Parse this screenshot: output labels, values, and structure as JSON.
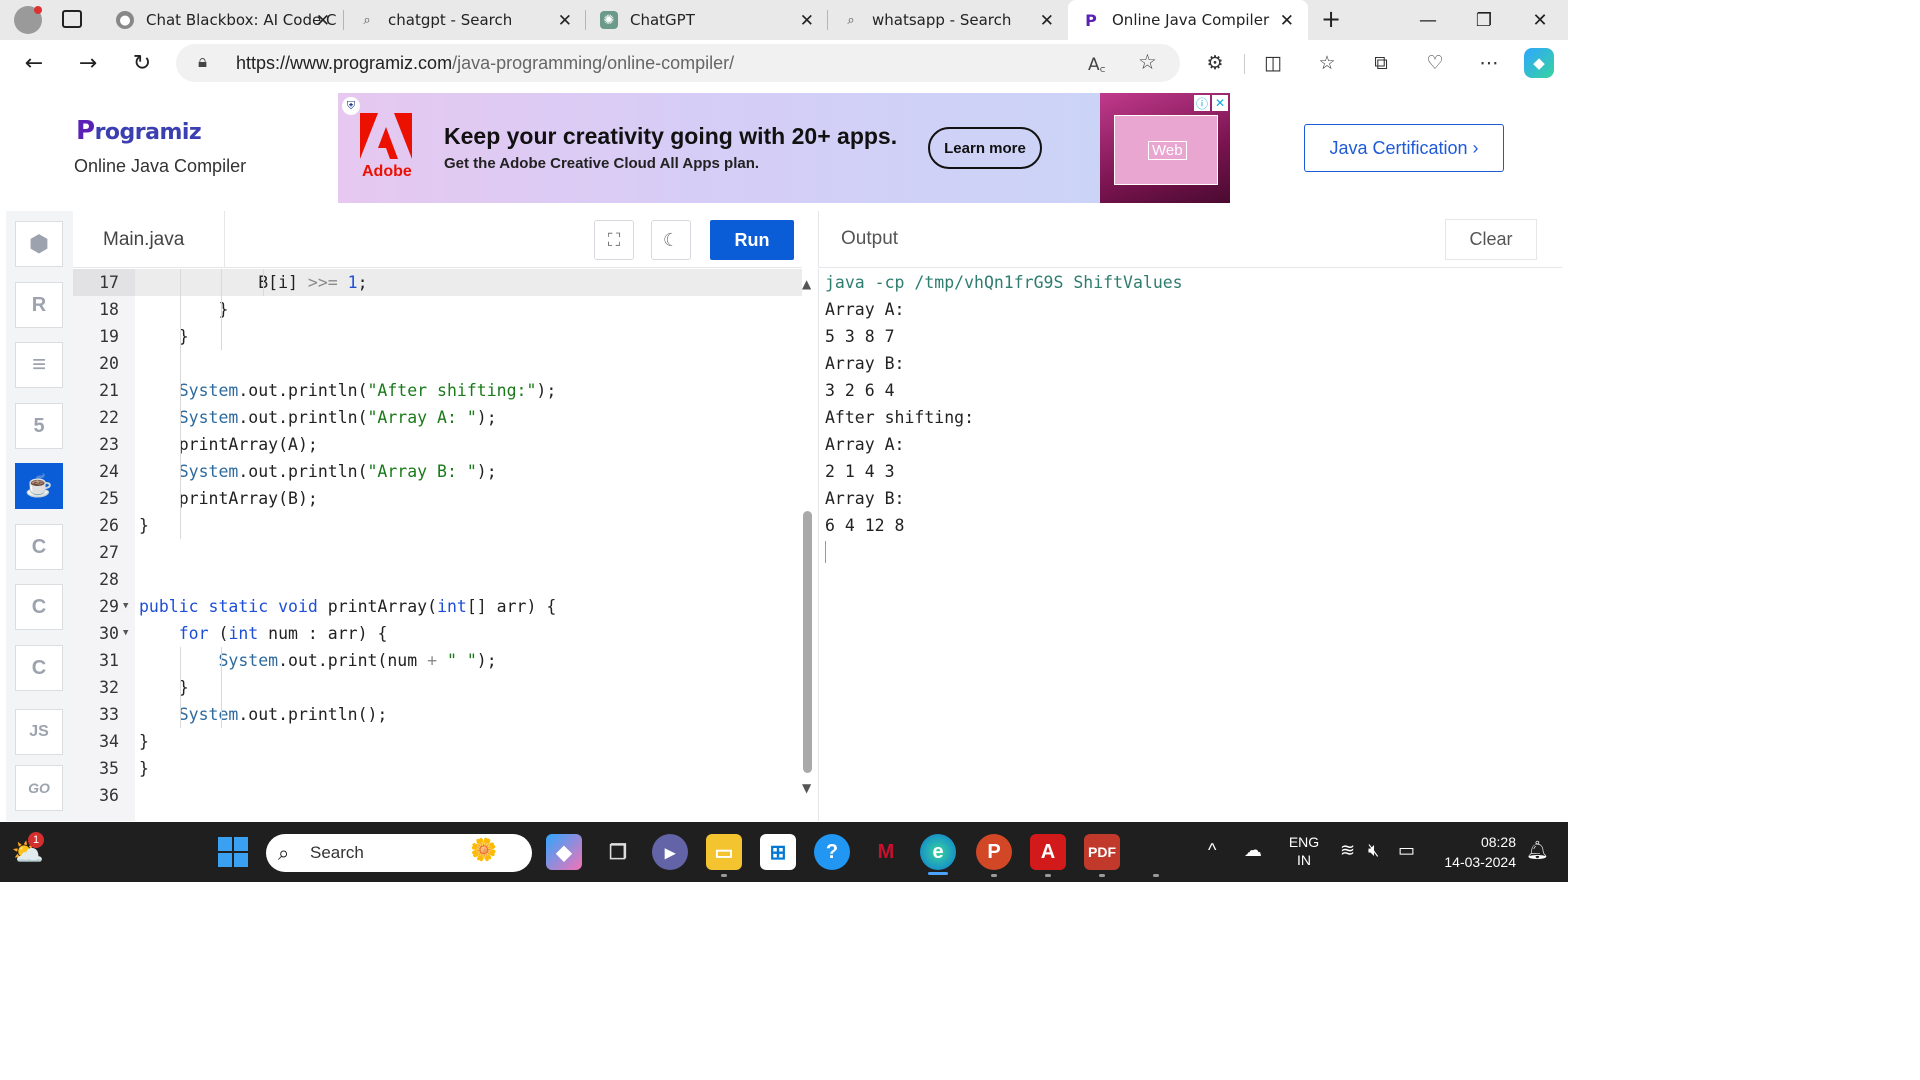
{
  "browser": {
    "tabs": [
      {
        "title": "Chat Blackbox: AI Code C",
        "icon": "blackbox-icon"
      },
      {
        "title": "chatgpt - Search",
        "icon": "search-icon"
      },
      {
        "title": "ChatGPT",
        "icon": "chatgpt-icon"
      },
      {
        "title": "whatsapp - Search",
        "icon": "search-icon"
      },
      {
        "title": "Online Java Compiler",
        "icon": "programiz-icon",
        "active": true
      }
    ],
    "url_host": "https://www.programiz.com",
    "url_path": "/java-programming/online-compiler/"
  },
  "site": {
    "logo_text": "rogramiz",
    "logo_initial": "P",
    "subtitle": "Online Java Compiler",
    "cert_button": "Java Certification ›"
  },
  "ad": {
    "brand": "Adobe",
    "headline": "Keep your creativity going with 20+ apps.",
    "subline": "Get the Adobe Creative Cloud All Apps plan.",
    "cta": "Learn more",
    "image_word": "Web"
  },
  "sidebar": {
    "languages": [
      {
        "name": "python-icon",
        "glyph": "🐍"
      },
      {
        "name": "r-icon",
        "glyph": "R"
      },
      {
        "name": "sql-icon",
        "glyph": "≡"
      },
      {
        "name": "html5-icon",
        "glyph": "5"
      },
      {
        "name": "java-icon",
        "glyph": "☕",
        "active": true
      },
      {
        "name": "c-icon",
        "glyph": "C"
      },
      {
        "name": "cpp-icon",
        "glyph": "C"
      },
      {
        "name": "csharp-icon",
        "glyph": "C"
      },
      {
        "name": "javascript-icon",
        "glyph": "JS"
      },
      {
        "name": "go-icon",
        "glyph": "GO"
      }
    ]
  },
  "editor": {
    "file_name": "Main.java",
    "run_label": "Run",
    "lines": [
      {
        "n": "17",
        "html": "            B[i] <span class=\"op\">>>=</span> <span class=\"num\">1</span>;",
        "hl": true
      },
      {
        "n": "18",
        "html": "        }"
      },
      {
        "n": "19",
        "html": "    }"
      },
      {
        "n": "20",
        "html": ""
      },
      {
        "n": "21",
        "html": "    <span class=\"fn\">System</span>.out.println(<span class=\"str\">\"After shifting:\"</span>);"
      },
      {
        "n": "22",
        "html": "    <span class=\"fn\">System</span>.out.println(<span class=\"str\">\"Array A: \"</span>);"
      },
      {
        "n": "23",
        "html": "    printArray(A);"
      },
      {
        "n": "24",
        "html": "    <span class=\"fn\">System</span>.out.println(<span class=\"str\">\"Array B: \"</span>);"
      },
      {
        "n": "25",
        "html": "    printArray(B);"
      },
      {
        "n": "26",
        "html": "}"
      },
      {
        "n": "27",
        "html": ""
      },
      {
        "n": "28",
        "html": ""
      },
      {
        "n": "29",
        "fold": true,
        "html": "<span class=\"kw\">public</span> <span class=\"kw\">static</span> <span class=\"kw\">void</span> printArray(<span class=\"kw\">int</span>[] arr) {"
      },
      {
        "n": "30",
        "fold": true,
        "html": "    <span class=\"kw\">for</span> (<span class=\"kw\">int</span> num : arr) {"
      },
      {
        "n": "31",
        "html": "        <span class=\"fn\">System</span>.out.print(num <span class=\"op\">+</span> <span class=\"str\">\" \"</span>);"
      },
      {
        "n": "32",
        "html": "    }"
      },
      {
        "n": "33",
        "html": "    <span class=\"fn\">System</span>.out.println();"
      },
      {
        "n": "34",
        "html": "}"
      },
      {
        "n": "35",
        "html": "}"
      },
      {
        "n": "36",
        "html": ""
      }
    ]
  },
  "output": {
    "title": "Output",
    "clear_label": "Clear",
    "lines": [
      {
        "text": "java -cp /tmp/vhQn1frG9S ShiftValues",
        "cmd": true
      },
      {
        "text": "Array A:"
      },
      {
        "text": "5 3 8 7"
      },
      {
        "text": "Array B:"
      },
      {
        "text": "3 2 6 4"
      },
      {
        "text": "After shifting:"
      },
      {
        "text": "Array A:"
      },
      {
        "text": "2 1 4 3"
      },
      {
        "text": "Array B:"
      },
      {
        "text": "6 4 12 8"
      }
    ]
  },
  "taskbar": {
    "search_placeholder": "Search",
    "weather_badge": "1",
    "lang_top": "ENG",
    "lang_bottom": "IN",
    "time": "08:28",
    "date": "14-03-2024"
  }
}
